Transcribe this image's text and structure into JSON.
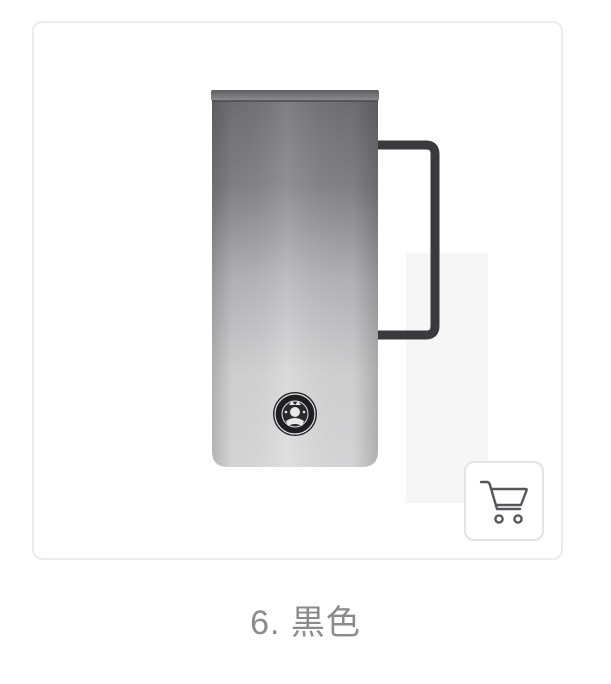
{
  "product": {
    "image_icon": "starbucks-stainless-mug",
    "logo_icon": "starbucks-siren-logo",
    "cart_icon": "shopping-cart-icon",
    "caption": "6. 黒色",
    "colors": {
      "card_border": "#ececee",
      "caption_text": "#8a8a8f",
      "mug_dark": "#7d7d7f",
      "mug_light": "#d9d9da",
      "handle": "#3a3a3c"
    }
  }
}
